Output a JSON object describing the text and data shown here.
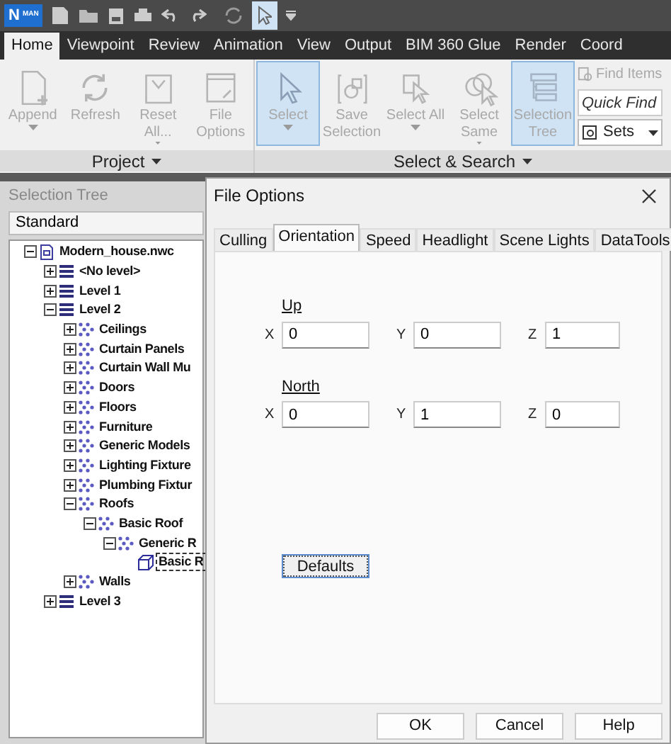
{
  "app_logo": {
    "letter": "N",
    "badge": "MAN"
  },
  "ribbon_tabs": [
    {
      "label": "Home",
      "selected": true
    },
    {
      "label": "Viewpoint",
      "selected": false
    },
    {
      "label": "Review",
      "selected": false
    },
    {
      "label": "Animation",
      "selected": false
    },
    {
      "label": "View",
      "selected": false
    },
    {
      "label": "Output",
      "selected": false
    },
    {
      "label": "BIM 360 Glue",
      "selected": false
    },
    {
      "label": "Render",
      "selected": false
    },
    {
      "label": "Coord",
      "selected": false
    }
  ],
  "ribbon_panels": [
    {
      "label": "Project",
      "buttons": [
        {
          "kind": "append",
          "label": "Append",
          "dropdown": true,
          "active": false
        },
        {
          "kind": "refresh",
          "label": "Refresh",
          "dropdown": false,
          "active": false
        },
        {
          "kind": "reset",
          "label": "Reset All...",
          "dropdown": true,
          "active": false
        },
        {
          "kind": "options",
          "label": "File Options",
          "dropdown": false,
          "active": false
        }
      ]
    },
    {
      "label": "Select & Search",
      "buttons": [
        {
          "kind": "select",
          "label": "Select",
          "dropdown": true,
          "active": true
        },
        {
          "kind": "save",
          "label": "Save Selection",
          "dropdown": false,
          "active": false
        },
        {
          "kind": "selectall",
          "label": "Select All",
          "dropdown": true,
          "active": false
        },
        {
          "kind": "selectsame",
          "label": "Select Same",
          "dropdown": true,
          "active": false
        },
        {
          "kind": "tree",
          "label": "Selection Tree",
          "dropdown": false,
          "active": true
        }
      ],
      "find_items": "Find Items",
      "quick_find": {
        "placeholder": "Quick Find"
      },
      "sets": "Sets"
    }
  ],
  "selection_tree": {
    "title": "Selection Tree",
    "mode": "Standard",
    "items": [
      {
        "kind": "file",
        "label": "Modern_house.nwc",
        "expanded": true,
        "selected": false,
        "children": [
          {
            "kind": "level",
            "label": "<No level>",
            "expanded": false,
            "selected": false
          },
          {
            "kind": "level",
            "label": "Level 1",
            "expanded": false,
            "selected": false
          },
          {
            "kind": "level",
            "label": "Level 2",
            "expanded": true,
            "selected": false,
            "children": [
              {
                "kind": "category",
                "label": "Ceilings",
                "expanded": false,
                "selected": false
              },
              {
                "kind": "category",
                "label": "Curtain Panels",
                "expanded": false,
                "selected": false
              },
              {
                "kind": "category",
                "label": "Curtain Wall Mu",
                "expanded": false,
                "selected": false
              },
              {
                "kind": "category",
                "label": "Doors",
                "expanded": false,
                "selected": false
              },
              {
                "kind": "category",
                "label": "Floors",
                "expanded": false,
                "selected": false
              },
              {
                "kind": "category",
                "label": "Furniture",
                "expanded": false,
                "selected": false
              },
              {
                "kind": "category",
                "label": "Generic Models",
                "expanded": false,
                "selected": false
              },
              {
                "kind": "category",
                "label": "Lighting Fixture",
                "expanded": false,
                "selected": false
              },
              {
                "kind": "category",
                "label": "Plumbing Fixtur",
                "expanded": false,
                "selected": false
              },
              {
                "kind": "category",
                "label": "Roofs",
                "expanded": true,
                "selected": false,
                "children": [
                  {
                    "kind": "category",
                    "label": "Basic Roof",
                    "expanded": true,
                    "selected": false,
                    "children": [
                      {
                        "kind": "category",
                        "label": "Generic R",
                        "expanded": true,
                        "selected": false,
                        "children": [
                          {
                            "kind": "geometry",
                            "label": "Basic R",
                            "selected": true
                          }
                        ]
                      }
                    ]
                  }
                ]
              },
              {
                "kind": "category",
                "label": "Walls",
                "expanded": false,
                "selected": false
              }
            ]
          },
          {
            "kind": "level",
            "label": "Level 3",
            "expanded": false,
            "selected": false
          }
        ]
      }
    ]
  },
  "dialog": {
    "title": "File Options",
    "tabs": [
      {
        "label": "Culling",
        "selected": false
      },
      {
        "label": "Orientation",
        "selected": true
      },
      {
        "label": "Speed",
        "selected": false
      },
      {
        "label": "Headlight",
        "selected": false
      },
      {
        "label": "Scene Lights",
        "selected": false
      },
      {
        "label": "DataTools",
        "selected": false
      }
    ],
    "groups": [
      {
        "label": "Up",
        "fields": [
          {
            "label": "X",
            "value": "0"
          },
          {
            "label": "Y",
            "value": "0"
          },
          {
            "label": "Z",
            "value": "1"
          }
        ]
      },
      {
        "label": "North",
        "fields": [
          {
            "label": "X",
            "value": "0"
          },
          {
            "label": "Y",
            "value": "1"
          },
          {
            "label": "Z",
            "value": "0"
          }
        ]
      }
    ],
    "defaults_button": "Defaults",
    "buttons": [
      "OK",
      "Cancel",
      "Help"
    ]
  }
}
